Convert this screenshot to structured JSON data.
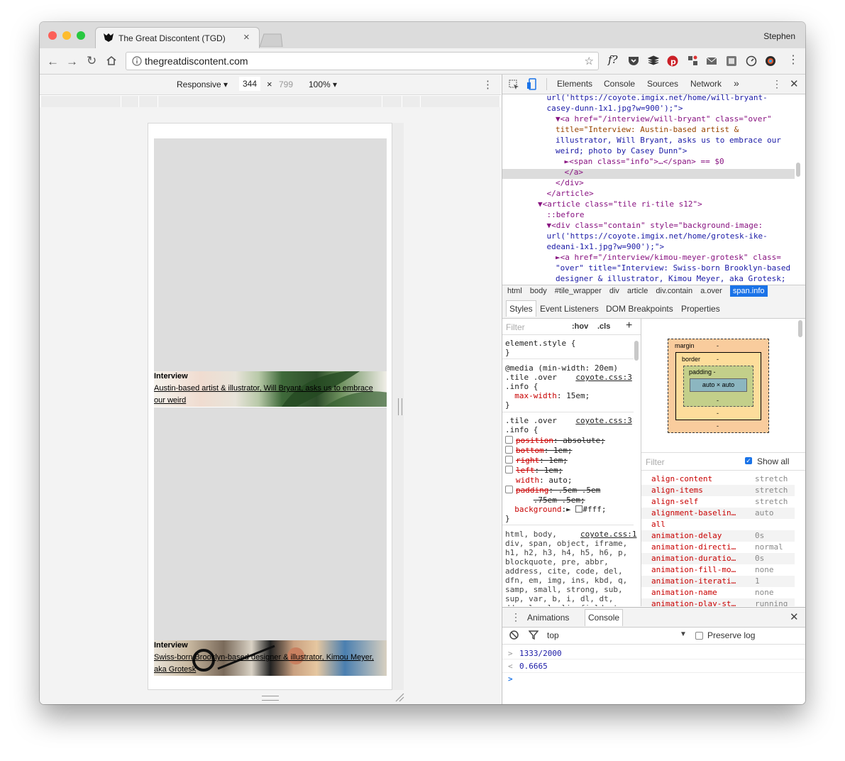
{
  "window": {
    "user_name": "Stephen",
    "tab_title": "The Great Discontent (TGD)",
    "tab_close": "×",
    "url": "thegreatdiscontent.com"
  },
  "device_toolbar": {
    "mode": "Responsive",
    "width": "344",
    "times": "×",
    "height": "799",
    "zoom": "100%"
  },
  "page": {
    "tile1": {
      "label": "Interview",
      "link": "Austin-based artist & illustrator, Will Bryant, asks us to embrace our weird"
    },
    "tile2": {
      "label": "Interview",
      "link": "Swiss-born Brooklyn-based designer & illustrator, Kimou Meyer, aka Grotesk"
    }
  },
  "devtools": {
    "tabs": [
      "Elements",
      "Console",
      "Sources",
      "Network"
    ],
    "more": "»",
    "dom_lines": [
      {
        "indent": 5,
        "html": "url('https://coyote.imgix.net/home/will-bryant-",
        "cls": "val"
      },
      {
        "indent": 5,
        "html": "casey-dunn-1x1.jpg?w=900');\">",
        "cls": "val"
      },
      {
        "indent": 6,
        "html": "▼<a href=\"/interview/will-bryant\" class=\"over\"",
        "cls": "tag"
      },
      {
        "indent": 6,
        "html": "title=\"Interview: Austin-based artist &",
        "cls": "attr"
      },
      {
        "indent": 6,
        "html": "illustrator, Will Bryant, asks us to embrace our",
        "cls": "val"
      },
      {
        "indent": 6,
        "html": "weird; photo by Casey Dunn\">",
        "cls": "val"
      },
      {
        "indent": 7,
        "html": "►<span class=\"info\">…</span> == $0",
        "cls": "tag"
      },
      {
        "indent": 7,
        "html": "</a>",
        "cls": "tag"
      },
      {
        "indent": 6,
        "html": "</div>",
        "cls": "tag"
      },
      {
        "indent": 5,
        "html": "</article>",
        "cls": "tag"
      },
      {
        "indent": 4,
        "html": "▼<article class=\"tile ri-tile s12\">",
        "cls": "tag"
      },
      {
        "indent": 5,
        "html": "::before",
        "cls": "tag"
      },
      {
        "indent": 5,
        "html": "▼<div class=\"contain\" style=\"background-image:",
        "cls": "tag"
      },
      {
        "indent": 5,
        "html": "url('https://coyote.imgix.net/home/grotesk-ike-",
        "cls": "val"
      },
      {
        "indent": 5,
        "html": "edeani-1x1.jpg?w=900');\">",
        "cls": "val"
      },
      {
        "indent": 6,
        "html": "►<a href=\"/interview/kimou-meyer-grotesk\" class=",
        "cls": "tag"
      },
      {
        "indent": 6,
        "html": "\"over\" title=\"Interview: Swiss-born Brooklyn-based",
        "cls": "val"
      },
      {
        "indent": 6,
        "html": "designer & illustrator, Kimou Meyer, aka Grotesk;",
        "cls": "val"
      }
    ],
    "breadcrumbs": [
      "html",
      "body",
      "#tile_wrapper",
      "div",
      "article",
      "div.contain",
      "a.over",
      "span.info"
    ],
    "subtabs": [
      "Styles",
      "Event Listeners",
      "DOM Breakpoints",
      "Properties"
    ],
    "styles_filter": "Filter",
    "hov": ":hov",
    "cls": ".cls",
    "plus": "+",
    "styles": {
      "element_style": "element.style {",
      "close": "}",
      "media": "@media (min-width: 20em)",
      "rule1_sel1": ".tile .over",
      "rule1_sel2": ".info {",
      "rule1_src": "coyote.css:3",
      "rule1_prop": "max-width",
      "rule1_val": "15em;",
      "rule2_sel1": ".tile .over",
      "rule2_sel2": ".info {",
      "rule2_src": "coyote.css:3",
      "rule2_props": [
        {
          "name": "position",
          "value": "absolute;",
          "struck": true
        },
        {
          "name": "bottom",
          "value": "1em;",
          "struck": true
        },
        {
          "name": "right",
          "value": "1em;",
          "struck": true
        },
        {
          "name": "left",
          "value": "1em;",
          "struck": true
        },
        {
          "name": "width",
          "value": "auto;",
          "struck": false
        },
        {
          "name": "padding",
          "value": ".5em .5em",
          "struck": true
        }
      ],
      "padding_cont": ".75em .5em;",
      "bg_name": "background",
      "bg_val": "#fff;",
      "rule3_sel": "html, body,",
      "rule3_src": "coyote.css:1",
      "rule3_lines": [
        "div, span, object, iframe,",
        "h1, h2, h3, h4, h5, h6, p,",
        "blockquote, pre, abbr,",
        "address, cite, code, del,",
        "dfn, em, img, ins, kbd, q,",
        "samp, small, strong, sub,",
        "sup, var, b, i, dl, dt,",
        "dd, ol, ul, li, fieldset,"
      ]
    },
    "box_model": {
      "margin": "margin",
      "border": "border",
      "padding": "padding -",
      "content": "auto × auto",
      "dash": "-"
    },
    "computed_filter": "Filter",
    "show_all": "Show all",
    "computed": [
      {
        "name": "align-content",
        "value": "stretch"
      },
      {
        "name": "align-items",
        "value": "stretch"
      },
      {
        "name": "align-self",
        "value": "stretch"
      },
      {
        "name": "alignment-baselin…",
        "value": "auto"
      },
      {
        "name": "all",
        "value": ""
      },
      {
        "name": "animation-delay",
        "value": "0s"
      },
      {
        "name": "animation-directi…",
        "value": "normal"
      },
      {
        "name": "animation-duratio…",
        "value": "0s"
      },
      {
        "name": "animation-fill-mo…",
        "value": "none"
      },
      {
        "name": "animation-iterati…",
        "value": "1"
      },
      {
        "name": "animation-name",
        "value": "none"
      },
      {
        "name": "animation-play-st…",
        "value": "running"
      }
    ],
    "drawer_tabs": [
      "Animations",
      "Console"
    ],
    "console_context": "top",
    "preserve_log": "Preserve log",
    "console_lines": [
      {
        "prefix": ">",
        "text": "1333/2000"
      },
      {
        "prefix": "<",
        "text": "0.6665"
      }
    ],
    "prompt": ">"
  }
}
